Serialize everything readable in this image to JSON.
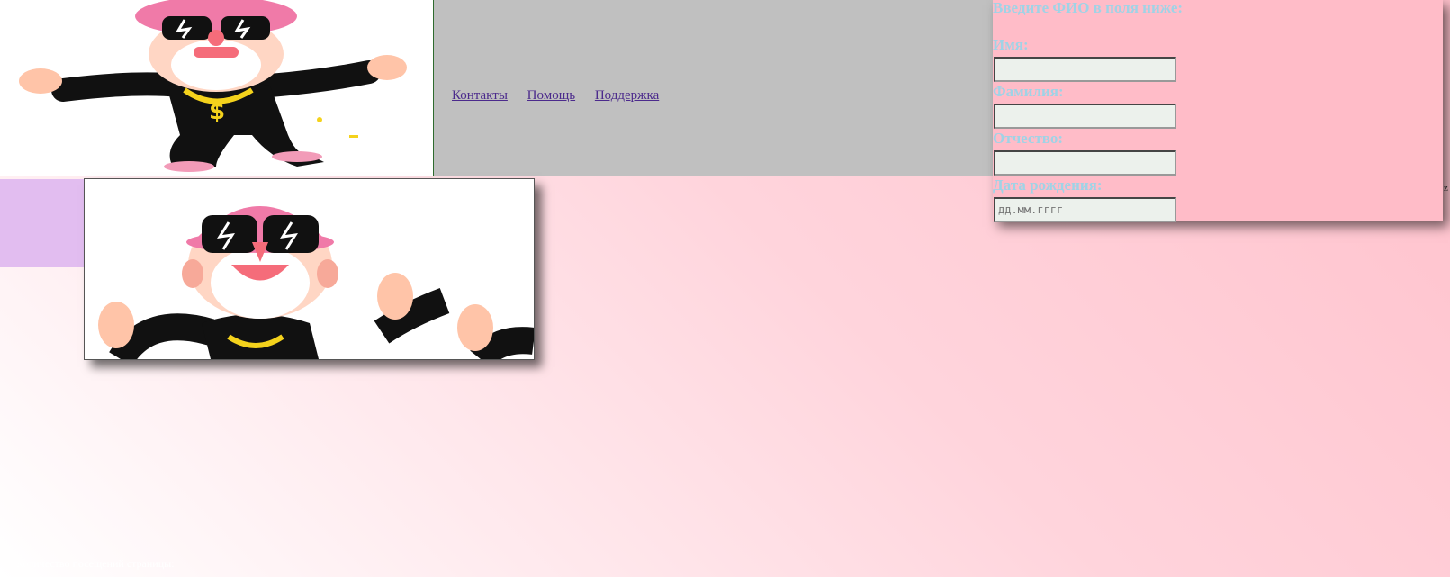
{
  "nav": {
    "links": [
      "Контакты",
      "Помощь",
      "Поддержка"
    ],
    "link_color": "#4b2a8c",
    "background": "#c0c0c0"
  },
  "form": {
    "title": "Введите ФИО в поля ниже:",
    "fields": [
      {
        "label": "Имя:",
        "value": "",
        "placeholder": ""
      },
      {
        "label": "Фамилия:",
        "value": "",
        "placeholder": ""
      },
      {
        "label": "Отчество:",
        "value": "",
        "placeholder": ""
      },
      {
        "label": "Дата рождения:",
        "value": "",
        "placeholder": "дд.мм.гггг"
      }
    ],
    "label_color": "#9fd3e6",
    "background": "#ffbcc8"
  },
  "images": {
    "top_logo": "cartoon-rapper-illustration",
    "main_picture": "cartoon-rapper-illustration-closeup"
  },
  "footer": {
    "text": "Количество посещений страницы:"
  },
  "misc": {
    "stray_char": "z"
  },
  "colors": {
    "sidebar": "#e2bdf0",
    "border": "#2e6b2e"
  }
}
